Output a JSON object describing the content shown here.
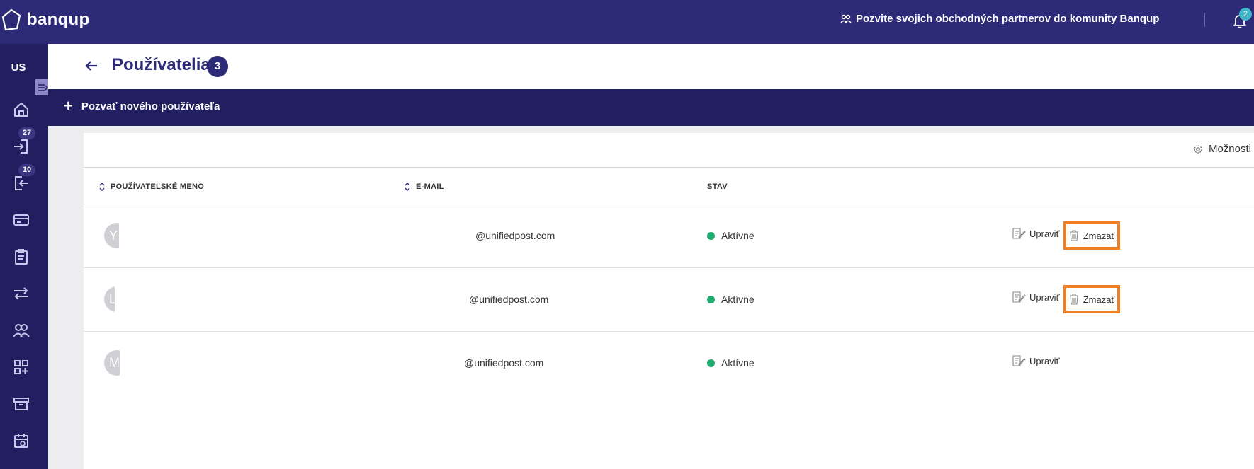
{
  "app": {
    "brand": "banqup",
    "invite_banner": "Pozvite svojich obchodných partnerov do komunity Banqup",
    "notifications_count": "2"
  },
  "sidebar": {
    "user_initials": "US",
    "items": [
      {
        "icon": "home-icon"
      },
      {
        "icon": "inbox-in-icon",
        "badge": "27"
      },
      {
        "icon": "outbox-out-icon",
        "badge": "10"
      },
      {
        "icon": "card-icon"
      },
      {
        "icon": "clipboard-icon"
      },
      {
        "icon": "transfer-icon"
      },
      {
        "icon": "users-icon"
      },
      {
        "icon": "apps-icon"
      },
      {
        "icon": "archive-icon"
      },
      {
        "icon": "calendar-icon"
      }
    ]
  },
  "page": {
    "title": "Používatelia",
    "count": "3"
  },
  "toolbar": {
    "invite_label": "Pozvať nového používateľa",
    "options_label": "Možnosti"
  },
  "table": {
    "columns": [
      "POUŽÍVATEĽSKÉ MENO",
      "E-MAIL",
      "STAV"
    ],
    "rows": [
      {
        "avatar": "Y",
        "email": "@unifiedpost.com",
        "status": "Aktívne",
        "edit": "Upraviť",
        "delete": "Zmazať"
      },
      {
        "avatar": "L",
        "email": "@unifiedpost.com",
        "status": "Aktívne",
        "edit": "Upraviť",
        "delete": "Zmazať"
      },
      {
        "avatar": "M",
        "email": "@unifiedpost.com",
        "status": "Aktívne",
        "edit": "Upraviť"
      }
    ]
  },
  "colors": {
    "topbar": "#2d2a78",
    "sidebar": "#221f60",
    "status_active": "#1fac6e",
    "highlight": "#f07e22"
  }
}
